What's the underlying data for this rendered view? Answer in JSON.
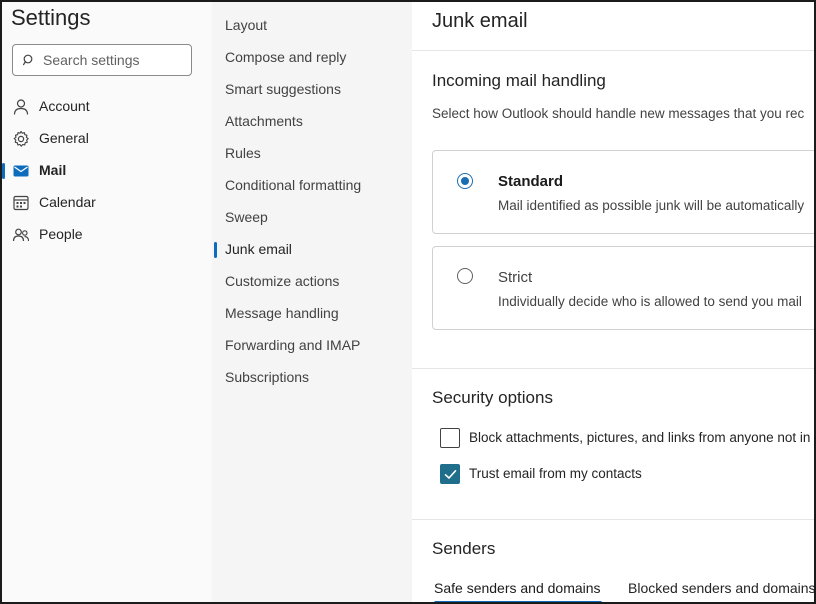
{
  "app": {
    "title": "Settings"
  },
  "search": {
    "placeholder": "Search settings"
  },
  "nav": [
    {
      "label": "Account",
      "icon": "person-icon",
      "active": false
    },
    {
      "label": "General",
      "icon": "gear-icon",
      "active": false
    },
    {
      "label": "Mail",
      "icon": "mail-icon",
      "active": true
    },
    {
      "label": "Calendar",
      "icon": "calendar-icon",
      "active": false
    },
    {
      "label": "People",
      "icon": "people-icon",
      "active": false
    }
  ],
  "subnav": [
    {
      "label": "Layout"
    },
    {
      "label": "Compose and reply"
    },
    {
      "label": "Smart suggestions"
    },
    {
      "label": "Attachments"
    },
    {
      "label": "Rules"
    },
    {
      "label": "Conditional formatting"
    },
    {
      "label": "Sweep"
    },
    {
      "label": "Junk email",
      "active": true
    },
    {
      "label": "Customize actions"
    },
    {
      "label": "Message handling"
    },
    {
      "label": "Forwarding and IMAP"
    },
    {
      "label": "Subscriptions"
    }
  ],
  "page": {
    "title": "Junk email",
    "incoming": {
      "heading": "Incoming mail handling",
      "description": "Select how Outlook should handle new messages that you rec",
      "options": [
        {
          "title": "Standard",
          "description": "Mail identified as possible junk will be automatically",
          "selected": true
        },
        {
          "title": "Strict",
          "description": "Individually decide who is allowed to send you mail",
          "selected": false
        }
      ]
    },
    "security": {
      "heading": "Security options",
      "options": [
        {
          "label": "Block attachments, pictures, and links from anyone not in",
          "checked": false
        },
        {
          "label": "Trust email from my contacts",
          "checked": true
        }
      ]
    },
    "senders": {
      "heading": "Senders",
      "tabs": [
        {
          "label": "Safe senders and domains",
          "active": true
        },
        {
          "label": "Blocked senders and domains",
          "active": false
        }
      ]
    }
  },
  "colors": {
    "accent": "#0f6cbd",
    "checkbox": "#1f6e8c",
    "radio": "#1a6fb3"
  }
}
